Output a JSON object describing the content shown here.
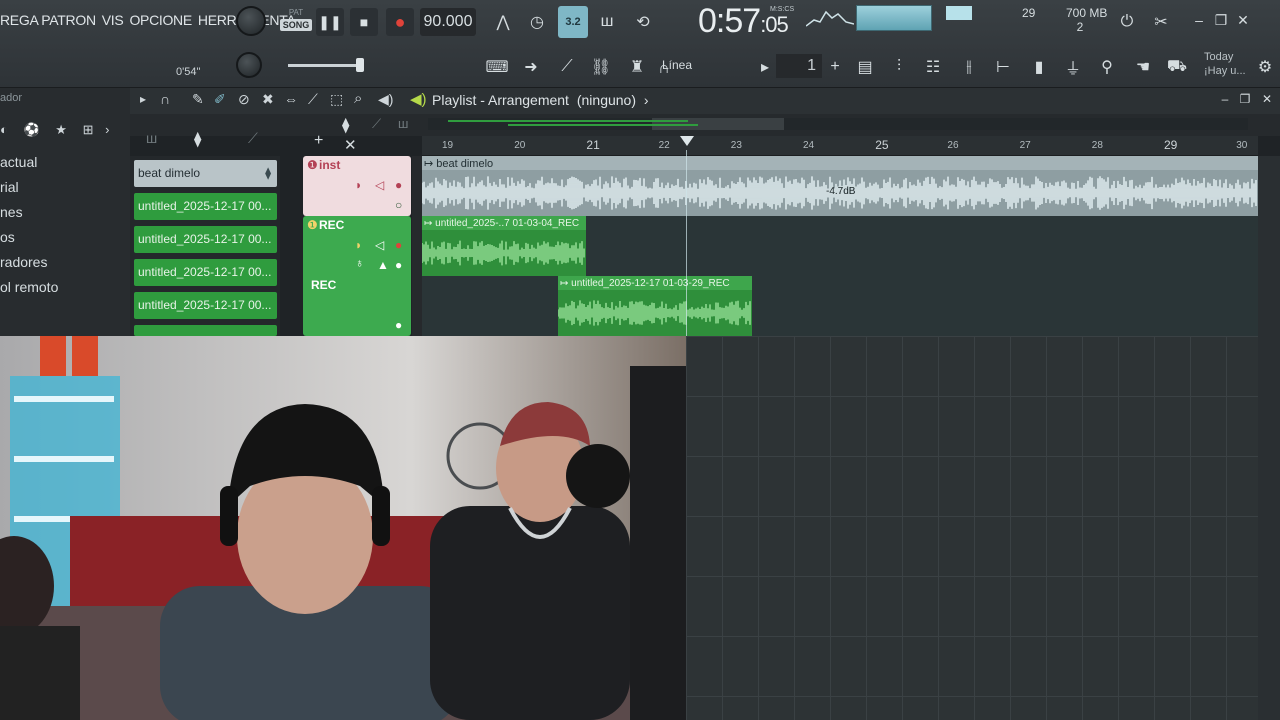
{
  "toolbar": {
    "menu": [
      "REGA PATRON",
      "VIS",
      "OPCIONE",
      "HERRAMIENTA"
    ],
    "pat_label": "PAT",
    "song_label": "SONG",
    "tempo": "90.000",
    "time_main": "0:57",
    "time_sub": ":05",
    "time_format": "M:S:CS",
    "cpu": "29",
    "memory": "700 MB",
    "voices": "2",
    "snap_label": "Línea",
    "pattern_number": "1",
    "pattern_plus": "+",
    "today_line1": "Today",
    "today_line2": "¡Hay u...",
    "time_offset": "0'54\"",
    "active_button": "3.2"
  },
  "browser": {
    "header": "ador",
    "items": [
      "actual",
      "rial",
      "nes",
      "os",
      "radores",
      "ol remoto"
    ]
  },
  "playlist": {
    "title": "Playlist - Arrangement",
    "subtitle": "(ninguno)",
    "bars": [
      "19",
      "20",
      "21",
      "22",
      "23",
      "24",
      "25",
      "26",
      "27",
      "28",
      "29",
      "30"
    ],
    "channels": [
      "beat dimelo",
      "untitled_2025-12-17 00...",
      "untitled_2025-12-17 00...",
      "untitled_2025-12-17 00...",
      "untitled_2025-12-17 00..."
    ],
    "tracks": [
      {
        "name": "inst"
      },
      {
        "name": "REC"
      },
      {
        "name": "REC"
      }
    ],
    "clips": [
      {
        "label": "beat dimelo",
        "gain": "-4.7dB"
      },
      {
        "label": "untitled_2025-..7 01-03-04_REC"
      },
      {
        "label": "untitled_2025-12-17 01-03-29_REC"
      }
    ]
  },
  "colors": {
    "accent": "#7fb7c6",
    "green_clip": "#2f9c3e",
    "inst_track": "#f0dcdf",
    "record": "#e0433a"
  }
}
